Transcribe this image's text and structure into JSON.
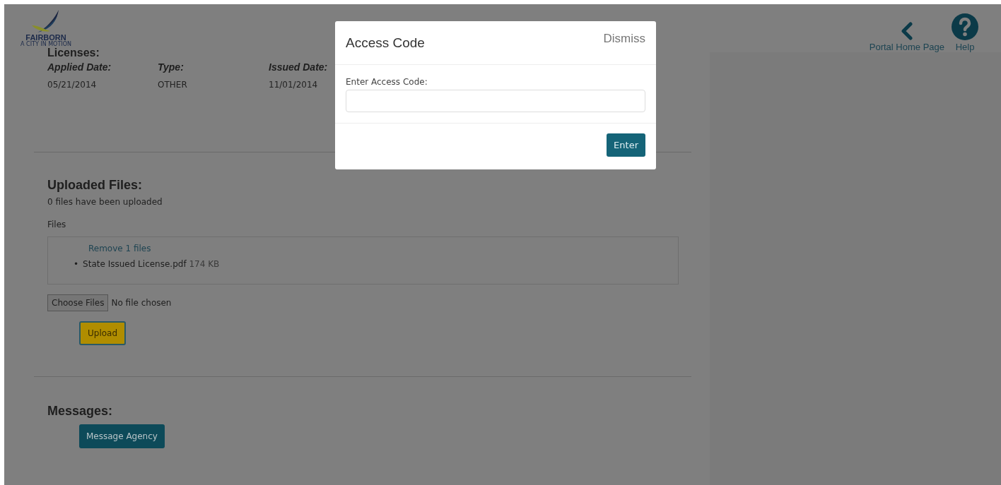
{
  "header": {
    "logo": {
      "name": "FAIRBORN",
      "tagline": "A CITY IN MOTION"
    },
    "nav": [
      {
        "kind": "back",
        "label": "Portal Home Page"
      },
      {
        "kind": "help",
        "label": "Help"
      }
    ]
  },
  "licenses": {
    "heading": "Licenses:",
    "columns": [
      "Applied Date:",
      "Type:",
      "Issued Date:"
    ],
    "row": [
      "05/21/2014",
      "OTHER",
      "11/01/2014"
    ]
  },
  "uploaded_files": {
    "heading": "Uploaded Files:",
    "summary": "0 files have been uploaded",
    "files_label": "Files",
    "remove_link": "Remove 1 files",
    "files": [
      {
        "marker": "•",
        "name": "State Issued License.pdf",
        "size": "174 KB"
      }
    ],
    "choose_button": "Choose Files",
    "chosen": "No file chosen",
    "upload_button": "Upload"
  },
  "messages": {
    "heading": "Messages:",
    "button": "Message Agency"
  },
  "modal": {
    "title": "Access Code",
    "dismiss": "Dismiss",
    "field_label": "Enter Access Code:",
    "button": "Enter"
  }
}
